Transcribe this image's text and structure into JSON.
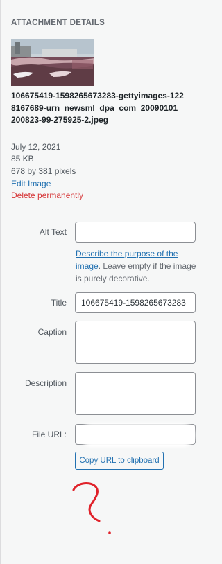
{
  "attachment_details": {
    "title": "ATTACHMENT DETAILS",
    "filename": "106675419-1598265673283-gettyimages-1228167689-urn_newsml_dpa_com_20090101_200823-99-275925-2.jpeg",
    "date": "July 12, 2021",
    "size": "85 KB",
    "dimensions": "678 by 381 pixels",
    "edit_label": "Edit Image",
    "delete_label": "Delete permanently"
  },
  "form": {
    "alt_text": {
      "label": "Alt Text",
      "value": "",
      "help_link": "Describe the purpose of the image",
      "help_text": ". Leave empty if the image is purely decorative."
    },
    "title": {
      "label": "Title",
      "value": "106675419-1598265673283"
    },
    "caption": {
      "label": "Caption",
      "value": ""
    },
    "description": {
      "label": "Description",
      "value": ""
    },
    "file_url": {
      "label": "File URL:",
      "value": ""
    },
    "copy_button": "Copy URL to clipboard"
  },
  "colors": {
    "link": "#2271b1",
    "danger": "#d63638",
    "annotation": "#e0222a"
  },
  "icons": {
    "annotation": "red-question-mark-annotation"
  }
}
